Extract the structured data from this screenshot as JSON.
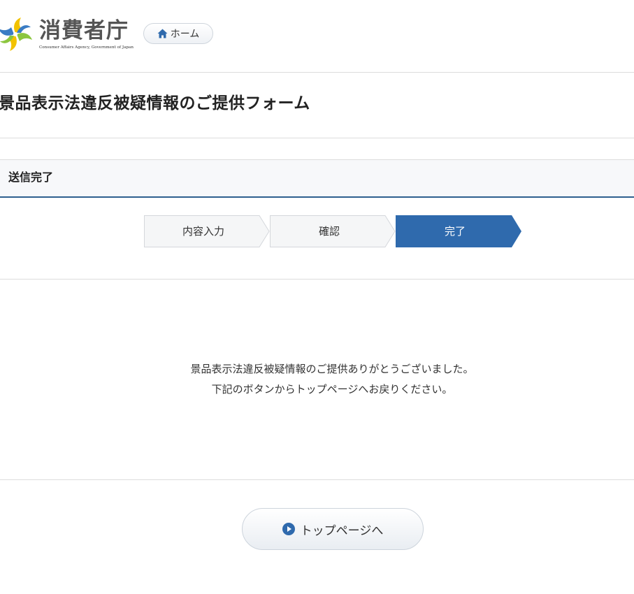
{
  "header": {
    "logo_title": "消費者庁",
    "logo_subtitle": "Consumer Affairs Agency, Government of Japan",
    "home_label": "ホーム"
  },
  "page": {
    "title": "景品表示法違反被疑情報のご提供フォーム",
    "section_title": "送信完了"
  },
  "steps": [
    {
      "label": "内容入力",
      "active": false
    },
    {
      "label": "確認",
      "active": false
    },
    {
      "label": "完了",
      "active": true
    }
  ],
  "message": {
    "line1": "景品表示法違反被疑情報のご提供ありがとうございました。",
    "line2": "下記のボタンからトップページへお戻りください。"
  },
  "actions": {
    "top_page_label": "トップページへ"
  },
  "colors": {
    "accent": "#2f6aad",
    "section_border": "#2e5f8e",
    "step_inactive_bg": "#f5f6f7"
  }
}
